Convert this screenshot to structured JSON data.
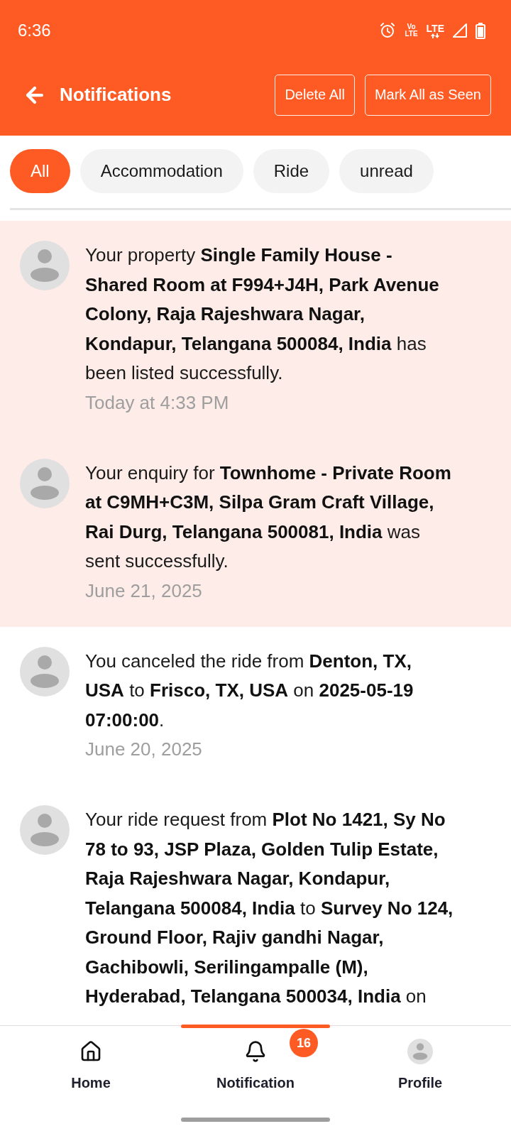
{
  "status_bar": {
    "time": "6:36",
    "volte_top": "Vo",
    "volte_bottom": "LTE",
    "network": "LTE"
  },
  "app_bar": {
    "title": "Notifications",
    "actions": [
      "Delete All",
      "Mark All as Seen"
    ]
  },
  "filters": [
    {
      "label": "All",
      "selected": true
    },
    {
      "label": "Accommodation",
      "selected": false
    },
    {
      "label": "Ride",
      "selected": false
    },
    {
      "label": "unread",
      "selected": false
    }
  ],
  "notifications": [
    {
      "message": "Your property **Single Family House - Shared Room at F994+J4H, Park Avenue Colony, Raja Rajeshwara Nagar, Kondapur, Telangana 500084, India** has been listed successfully.",
      "time": "Today at 4:33 PM",
      "unread": true
    },
    {
      "message": "Your enquiry for **Townhome - Private Room at C9MH+C3M, Silpa Gram Craft Village, Rai Durg, Telangana 500081, India** was sent successfully.",
      "time": "June 21, 2025",
      "unread": true
    },
    {
      "message": "You canceled the ride from **Denton, TX, USA** to **Frisco, TX, USA** on **2025-05-19 07:00:00**.",
      "time": "June 20, 2025",
      "unread": false
    },
    {
      "message": "Your ride request from **Plot No 1421, Sy No 78 to 93, JSP Plaza, Golden Tulip Estate, Raja Rajeshwara Nagar, Kondapur, Telangana 500084, India** to **Survey No 124, Ground Floor, Rajiv gandhi Nagar, Gachibowli, Serilingampalle (M), Hyderabad, Telangana 500034, India** on",
      "unread": false
    }
  ],
  "bottom_nav": [
    {
      "label": "Home",
      "kind": "home",
      "selected": false
    },
    {
      "label": "Notification",
      "kind": "bell",
      "selected": true,
      "badge": "16"
    },
    {
      "label": "Profile",
      "kind": "avatar",
      "selected": false
    }
  ]
}
